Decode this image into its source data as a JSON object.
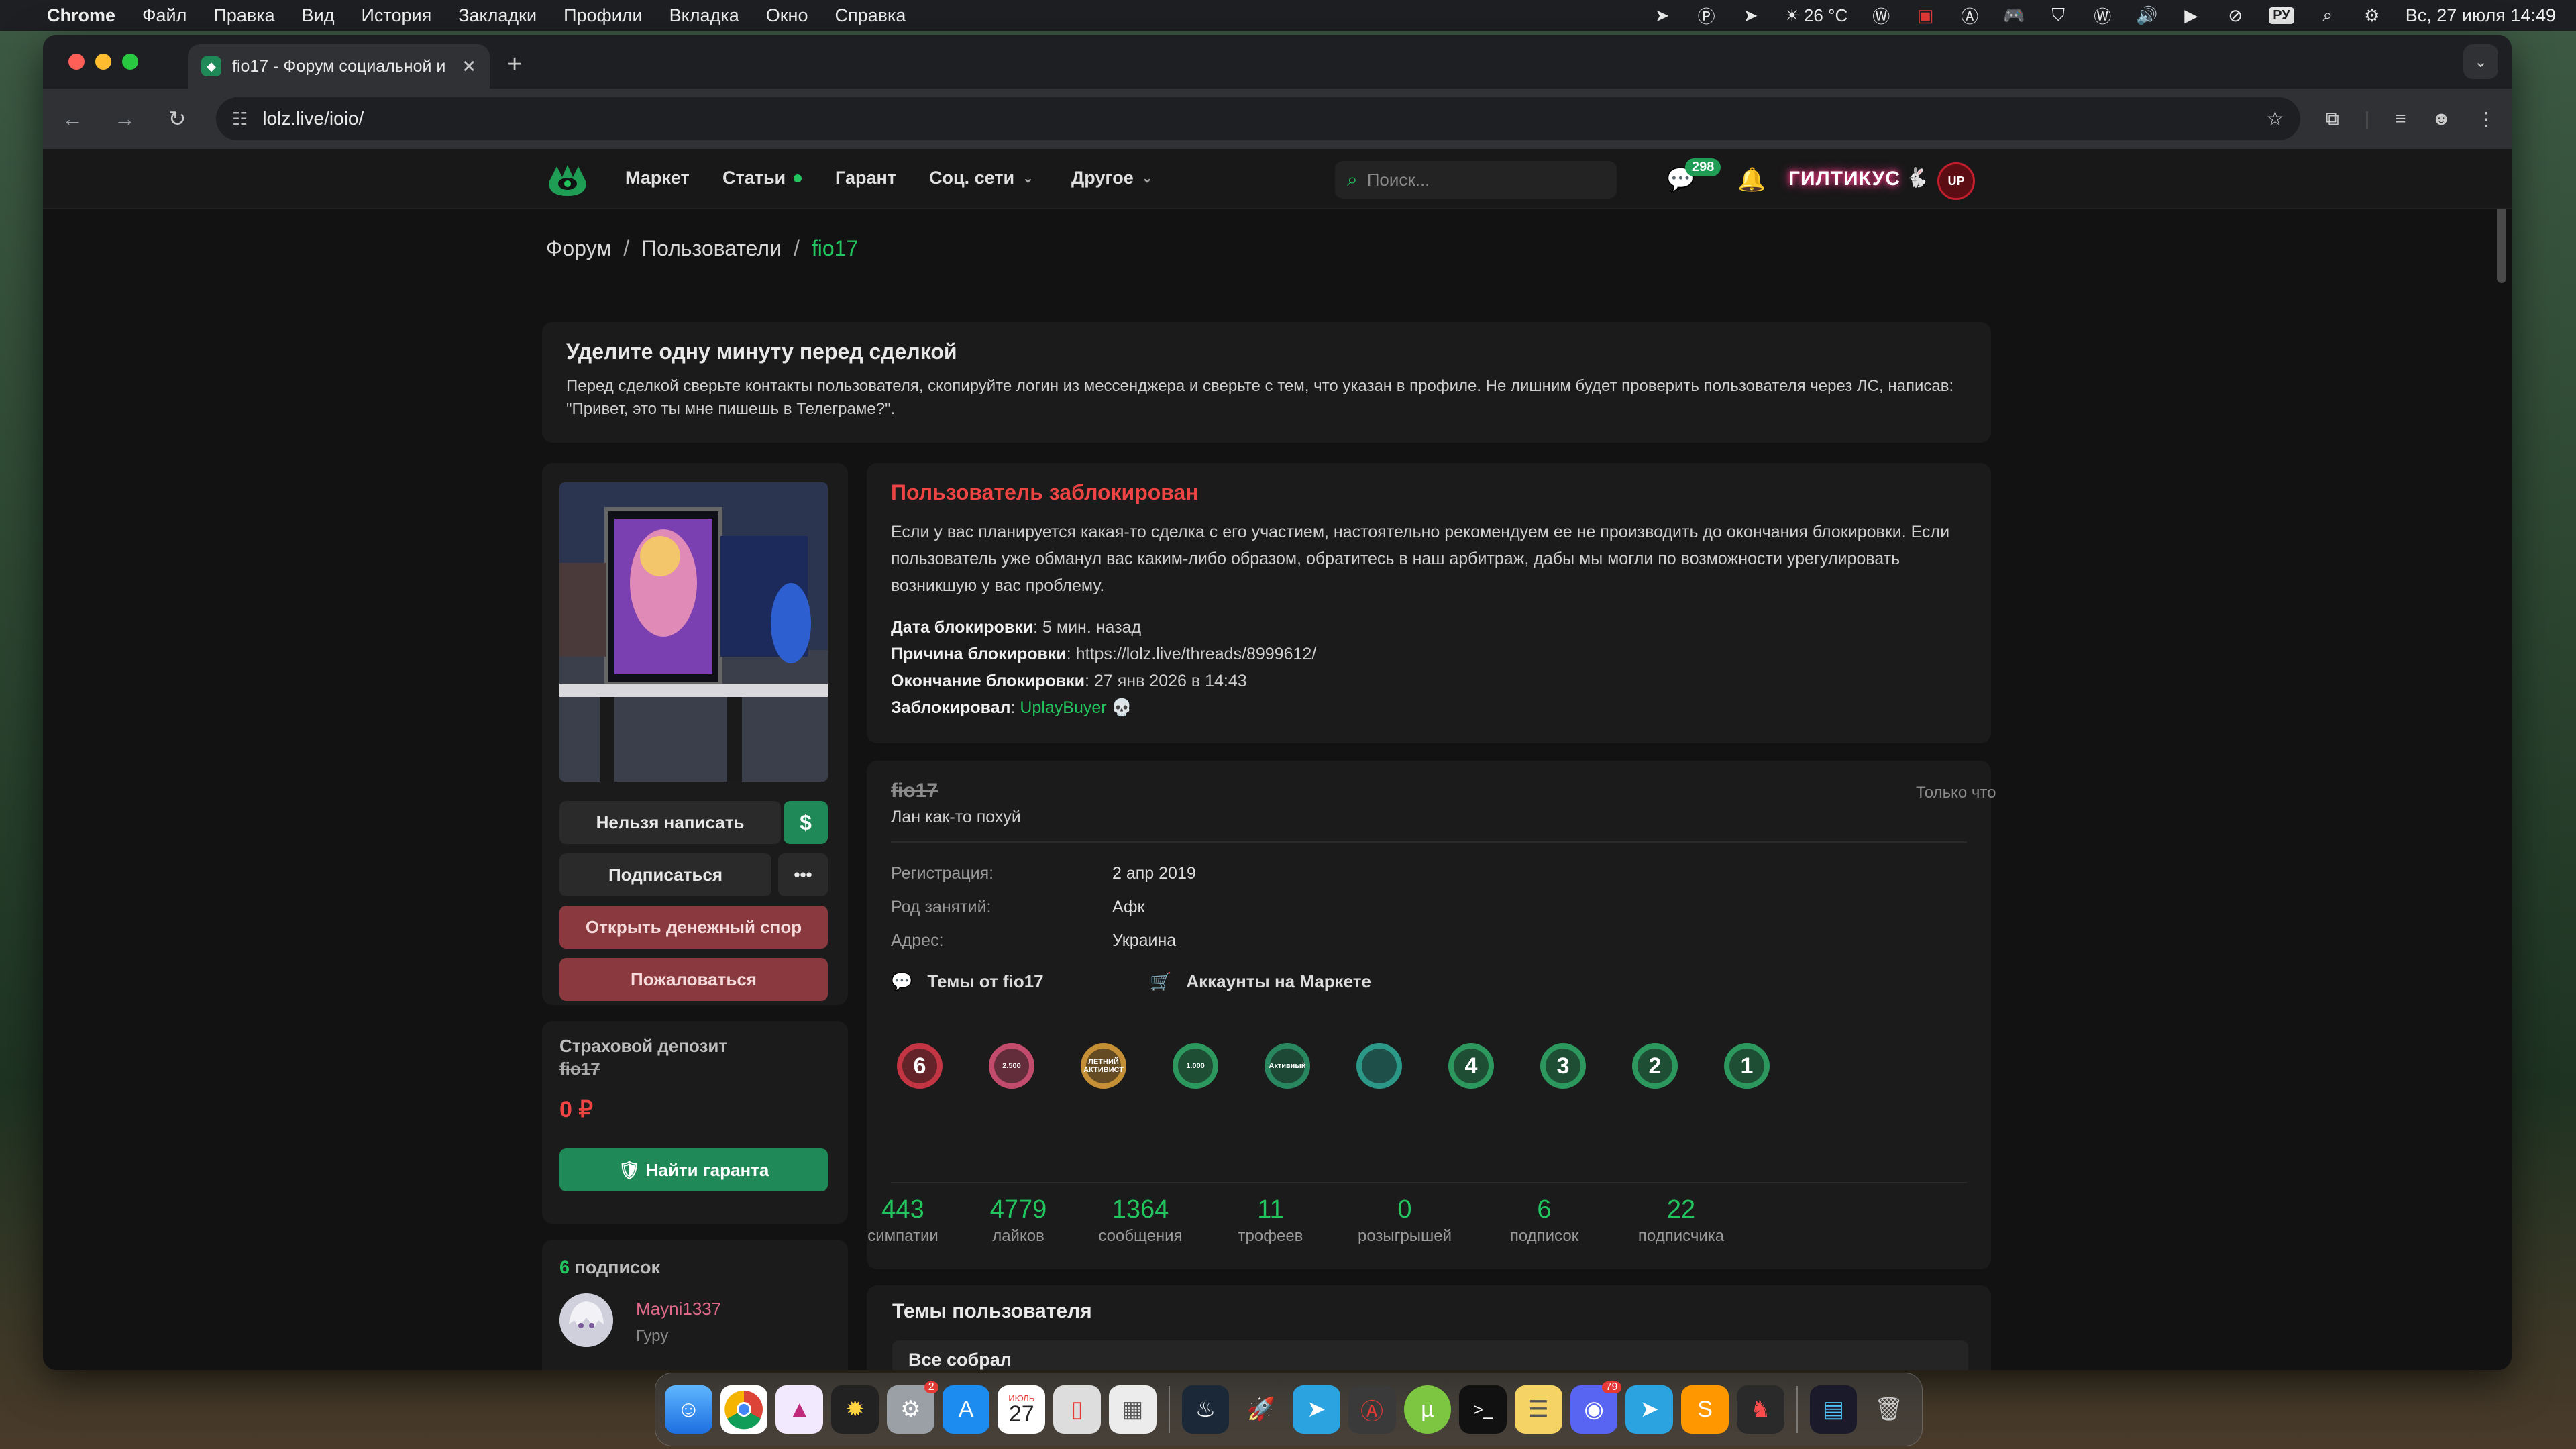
{
  "menubar": {
    "app": "Chrome",
    "items": [
      "Файл",
      "Правка",
      "Вид",
      "История",
      "Закладки",
      "Профили",
      "Вкладка",
      "Окно",
      "Справка"
    ],
    "weather": "26 °C",
    "kbd": "РУ",
    "datetime": "Вс, 27 июля  14:49"
  },
  "browser": {
    "tab_title": "fio17 - Форум социальной и",
    "url": "lolz.live/ioio/"
  },
  "site": {
    "nav": {
      "market": "Маркет",
      "articles": "Статьи",
      "guarantor": "Гарант",
      "social": "Соц. сети",
      "other": "Другое"
    },
    "search_placeholder": "Поиск...",
    "messages_count": "298",
    "nick": "ГИЛТИКУС",
    "avatar_initials": "UP"
  },
  "breadcrumb": {
    "forum": "Форум",
    "users": "Пользователи",
    "current": "fio17"
  },
  "notice": {
    "title": "Уделите одну минуту перед сделкой",
    "text": "Перед сделкой сверьте контакты пользователя, скопируйте логин из мессенджера и сверьте с тем, что указан в профиле. Не лишним будет проверить пользователя через ЛС, написав: \"Привет, это ты мне пишешь в Телеграме?\"."
  },
  "sidebar": {
    "cant_write": "Нельзя написать",
    "dollar": "$",
    "subscribe": "Подписаться",
    "more": "•••",
    "dispute": "Открыть денежный спор",
    "report": "Пожаловаться",
    "deposit_title": "Страховой депозит",
    "deposit_user": "fio17",
    "deposit_amount": "0 ₽",
    "find_guarantor": "Найти гаранта",
    "subs_count": "6",
    "subs_label": "подписок",
    "sub_user": "Mayni1337",
    "sub_rank": "Гуру"
  },
  "blocked": {
    "title": "Пользователь заблокирован",
    "text": "Если у вас планируется какая-то сделка с его участием, настоятельно рекомендуем ее не производить до окончания блокировки. Если пользователь уже обманул вас каким-либо образом, обратитесь в наш арбитраж, дабы мы могли по возможности урегулировать возникшую у вас проблему.",
    "date_label": "Дата блокировки",
    "date_val": "5 мин. назад",
    "reason_label": "Причина блокировки",
    "reason_val": "https://lolz.live/threads/8999612/",
    "end_label": "Окончание блокировки",
    "end_val": "27 янв 2026 в 14:43",
    "by_label": "Заблокировал",
    "by_val": "UplayBuyer"
  },
  "profile": {
    "username": "fio17",
    "status": "Лан как-то похуй",
    "last_seen": "Только что",
    "reg_label": "Регистрация:",
    "reg_val": "2 апр 2019",
    "occ_label": "Род занятий:",
    "occ_val": "Афк",
    "addr_label": "Адрес:",
    "addr_val": "Украина",
    "threads_link": "Темы от fio17",
    "market_link": "Аккаунты на Маркете",
    "trophies": [
      {
        "icon": "trophy-6-icon",
        "text": "6"
      },
      {
        "icon": "trophy-2500-likes-icon",
        "text": "2.500"
      },
      {
        "icon": "trophy-summer-active-icon",
        "text": "ЛЕТНИЙ АКТИВИСТ"
      },
      {
        "icon": "trophy-1000-likes-icon",
        "text": "1.000"
      },
      {
        "icon": "trophy-active-member-icon",
        "text": "Активный"
      },
      {
        "icon": "trophy-chat-icon",
        "text": ""
      },
      {
        "icon": "trophy-4-years-icon",
        "text": "4"
      },
      {
        "icon": "trophy-3-years-icon",
        "text": "3"
      },
      {
        "icon": "trophy-2-years-icon",
        "text": "2"
      },
      {
        "icon": "trophy-1-year-icon",
        "text": "1"
      }
    ],
    "stats": [
      {
        "num": "443",
        "label": "симпатии"
      },
      {
        "num": "4779",
        "label": "лайков"
      },
      {
        "num": "1364",
        "label": "сообщения"
      },
      {
        "num": "11",
        "label": "трофеев"
      },
      {
        "num": "0",
        "label": "розыгрышей"
      },
      {
        "num": "6",
        "label": "подписок"
      },
      {
        "num": "22",
        "label": "подписчика"
      }
    ]
  },
  "threads": {
    "title": "Темы пользователя",
    "tab_all": "Все собрал"
  },
  "dock": {
    "calendar_month": "ИЮЛЬ",
    "calendar_day": "27",
    "notif_a": "2",
    "notif_b": "79"
  },
  "colors": {
    "accent": "#22c55e",
    "danger": "#ef4444",
    "button_red": "#8a3a3f",
    "button_green": "#1f8a57"
  }
}
